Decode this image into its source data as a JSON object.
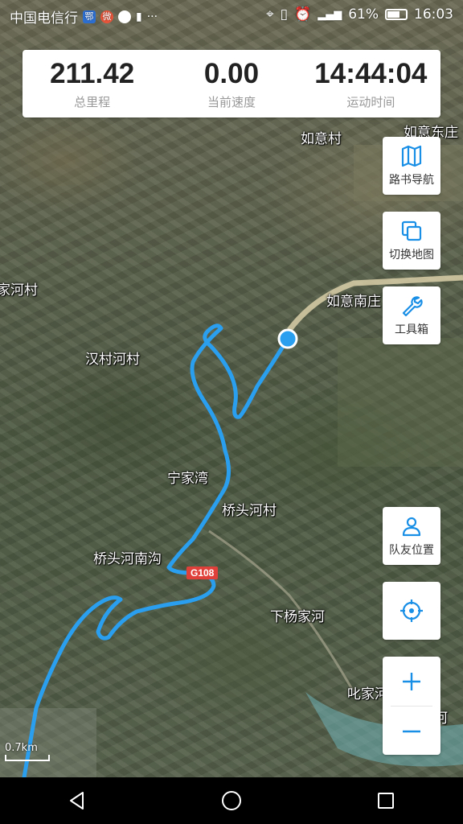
{
  "status_bar": {
    "carrier": "中国电信行",
    "battery": "61%",
    "time": "16:03"
  },
  "stats": {
    "distance_value": "211.42",
    "distance_label": "总里程",
    "speed_value": "0.00",
    "speed_label": "当前速度",
    "time_value": "14:44:04",
    "time_label": "运动时间"
  },
  "side_buttons": {
    "nav": "路书导航",
    "switch_map": "切换地图",
    "tools": "工具箱",
    "team": "队友位置"
  },
  "places": {
    "ruyi": "如意村",
    "ruyi_east": "如意东庄",
    "ruyi_south": "如意南庄",
    "jiahe": "家河村",
    "hancun": "汉村河村",
    "ningjiawan": "宁家湾",
    "qiaotou": "桥头河村",
    "qiaotou_south": "桥头河南沟",
    "xiayang": "下杨家河",
    "chijia": "叱家河",
    "lijia": "李家河"
  },
  "road_badge": "G108",
  "scale_label": "0.7km",
  "colors": {
    "track": "#2196f3",
    "accent": "#1a8fe6"
  }
}
